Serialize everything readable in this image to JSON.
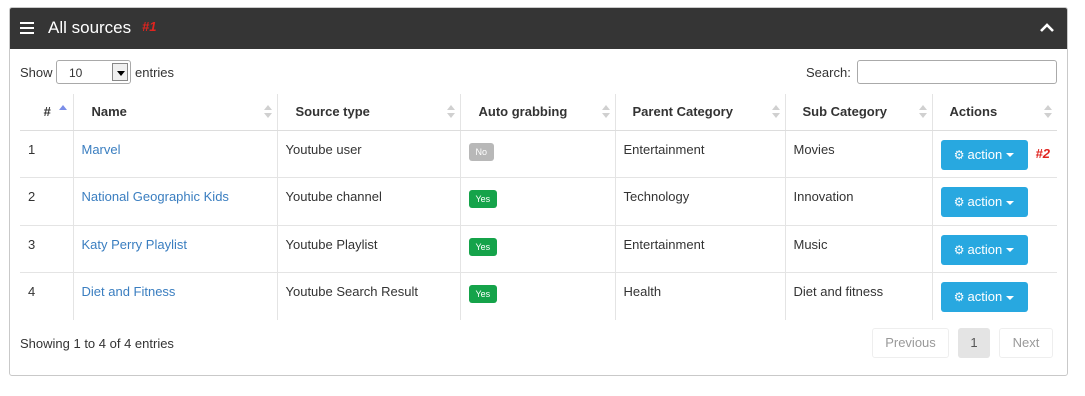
{
  "header": {
    "title": "All sources",
    "annotation": "#1",
    "menu_icon": "hamburger-icon",
    "collapse_icon": "chevron-up-icon"
  },
  "controls": {
    "show_label": "Show",
    "page_size": "10",
    "entries_label": "entries",
    "search_label": "Search:",
    "search_value": ""
  },
  "table": {
    "columns": [
      "#",
      "Name",
      "Source type",
      "Auto grabbing",
      "Parent Category",
      "Sub Category",
      "Actions"
    ],
    "rows": [
      {
        "num": "1",
        "name": "Marvel",
        "source_type": "Youtube user",
        "auto": "No",
        "parent": "Entertainment",
        "sub": "Movies",
        "action": "action"
      },
      {
        "num": "2",
        "name": "National Geographic Kids",
        "source_type": "Youtube channel",
        "auto": "Yes",
        "parent": "Technology",
        "sub": "Innovation",
        "action": "action"
      },
      {
        "num": "3",
        "name": "Katy Perry Playlist",
        "source_type": "Youtube Playlist",
        "auto": "Yes",
        "parent": "Entertainment",
        "sub": "Music",
        "action": "action"
      },
      {
        "num": "4",
        "name": "Diet and Fitness",
        "source_type": "Youtube Search Result",
        "auto": "Yes",
        "parent": "Health",
        "sub": "Diet and fitness",
        "action": "action"
      }
    ],
    "action_annotation": "#2"
  },
  "footer": {
    "info": "Showing 1 to 4 of 4 entries",
    "previous": "Previous",
    "page": "1",
    "next": "Next"
  },
  "colors": {
    "header_bg": "#353535",
    "link": "#3a7ec0",
    "yes_badge": "#15a34a",
    "no_badge": "#b8b8b8",
    "action_button": "#28a8e0",
    "annotation": "#e0241f"
  }
}
